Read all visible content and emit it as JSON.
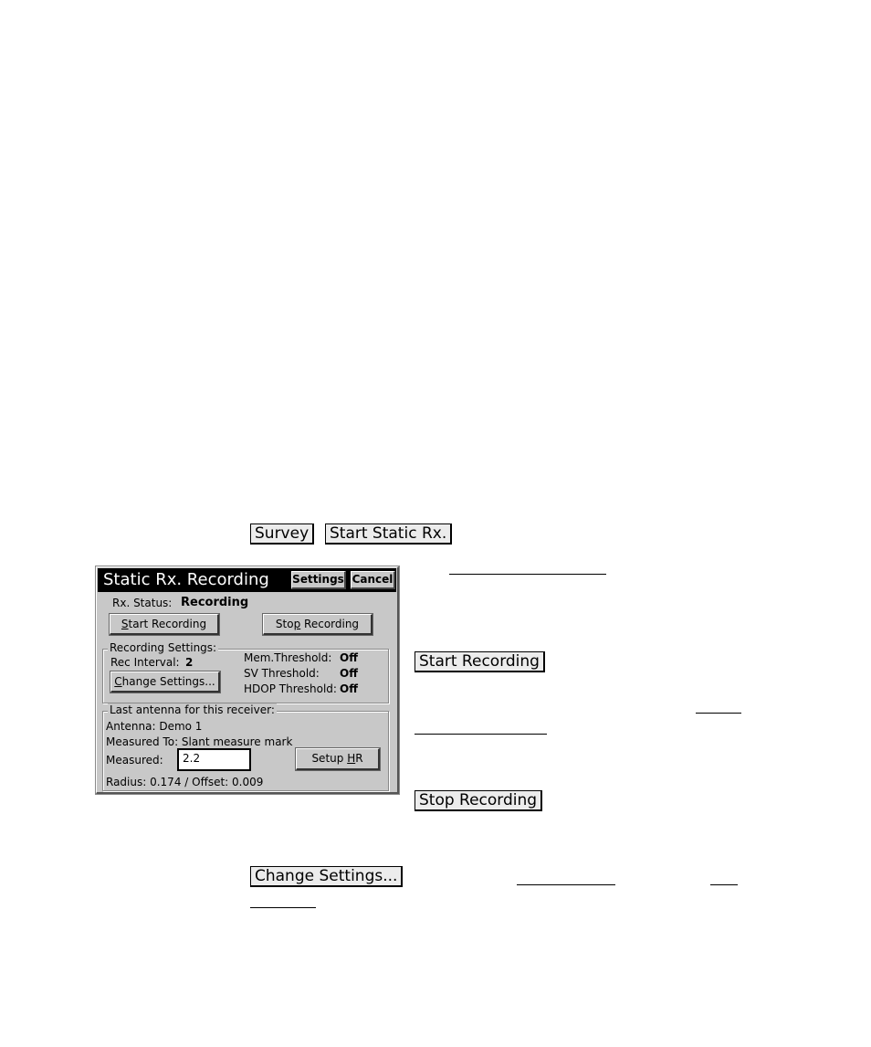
{
  "doc": {
    "inline_buttons": {
      "survey": "Survey",
      "start_static": "Start Static Rx.",
      "start_recording": "Start Recording",
      "stop_recording": "Stop Recording",
      "change_settings": "Change Settings..."
    }
  },
  "dialog": {
    "title": "Static Rx. Recording",
    "settings_button": "Settings",
    "cancel_button": "Cancel",
    "rx_status_label": "Rx. Status:",
    "rx_status_value": "Recording",
    "start_recording_button": {
      "pre": "",
      "u": "S",
      "post": "tart Recording"
    },
    "stop_recording_button": {
      "pre": "Sto",
      "u": "p",
      "post": " Recording"
    },
    "recording_settings": {
      "group_label": "Recording Settings:",
      "rec_interval_label": "Rec Interval:",
      "rec_interval_value": "2",
      "change_settings_button": {
        "pre": "",
        "u": "C",
        "post": "hange Settings..."
      },
      "mem_threshold_label": "Mem.Threshold:",
      "mem_threshold_value": "Off",
      "sv_threshold_label": "SV Threshold:",
      "sv_threshold_value": "Off",
      "hdop_threshold_label": "HDOP Threshold:",
      "hdop_threshold_value": "Off"
    },
    "antenna": {
      "group_label": "Last antenna for this receiver:",
      "antenna_line": "Antenna: Demo 1",
      "measured_to_line": "Measured To: Slant measure mark",
      "measured_label": "Measured:",
      "measured_value": "2.2",
      "setup_hr_button": {
        "pre": "Setup ",
        "u": "H",
        "post": "R"
      },
      "radius_offset_line": "Radius: 0.174 / Offset: 0.009"
    }
  }
}
